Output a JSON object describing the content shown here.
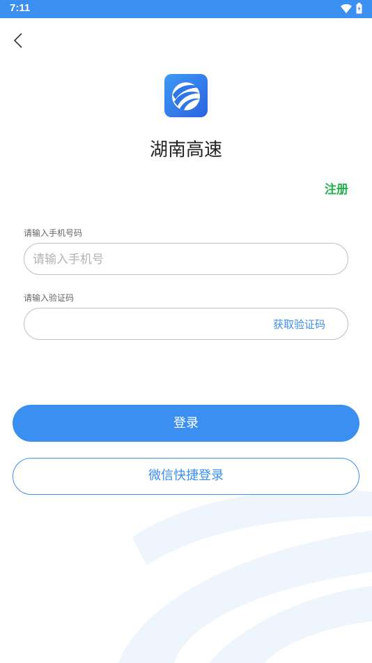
{
  "status_bar": {
    "time": "7:11",
    "icons": [
      "wifi-icon",
      "battery-icon"
    ]
  },
  "nav": {
    "back_icon": "chevron-left-icon"
  },
  "app": {
    "title": "湖南高速",
    "logo_icon": "hunan-expressway-logo-icon"
  },
  "register": {
    "label": "注册"
  },
  "phone": {
    "label": "请输入手机号码",
    "placeholder": "请输入手机号",
    "value": ""
  },
  "code": {
    "label": "请输入验证码",
    "placeholder": "",
    "value": "",
    "get_code_label": "获取验证码"
  },
  "actions": {
    "login_label": "登录",
    "wechat_login_label": "微信快捷登录"
  },
  "colors": {
    "primary": "#3a8ff0",
    "register_green": "#22b14c",
    "input_border": "#b5c4cf",
    "background": "#ffffff"
  }
}
